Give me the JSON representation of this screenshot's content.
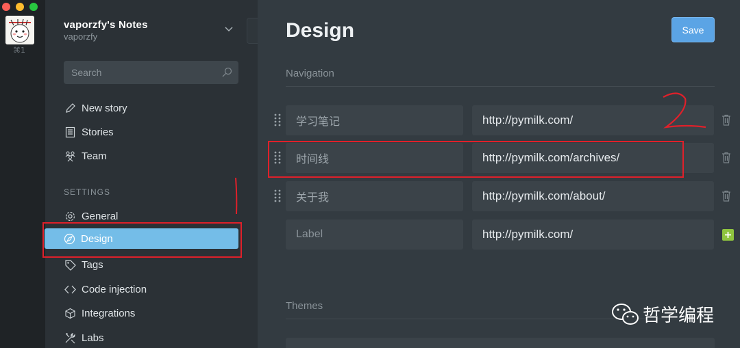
{
  "rail": {
    "avatar_icon": "avatar-sticker",
    "shortcut": "⌘1"
  },
  "sidebar": {
    "blog_title": "vaporzfy's Notes",
    "blog_user": "vaporzfy",
    "search_placeholder": "Search",
    "items": [
      {
        "label": "New story",
        "icon": "pen-icon"
      },
      {
        "label": "Stories",
        "icon": "list-icon"
      },
      {
        "label": "Team",
        "icon": "team-icon"
      }
    ],
    "settings_heading": "SETTINGS",
    "settings_items": [
      {
        "label": "General",
        "icon": "gear-icon"
      },
      {
        "label": "Design",
        "icon": "compass-icon",
        "active": true
      },
      {
        "label": "Tags",
        "icon": "tag-icon"
      },
      {
        "label": "Code injection",
        "icon": "code-icon"
      },
      {
        "label": "Integrations",
        "icon": "box-icon"
      },
      {
        "label": "Labs",
        "icon": "tools-icon"
      }
    ]
  },
  "main": {
    "title": "Design",
    "save_label": "Save",
    "navigation_heading": "Navigation",
    "nav_rows": [
      {
        "label": "学习笔记",
        "url": "http://pymilk.com/"
      },
      {
        "label": "时间线",
        "url": "http://pymilk.com/archives/"
      },
      {
        "label": "关于我",
        "url": "http://pymilk.com/about/"
      }
    ],
    "new_row": {
      "label_placeholder": "Label",
      "url": "http://pymilk.com/"
    },
    "themes_heading": "Themes"
  },
  "annotations": {
    "mark_1": "1",
    "mark_2": "2"
  },
  "watermark": "哲学编程",
  "colors": {
    "accent": "#74bde8",
    "save": "#5ba4e5",
    "add": "#8fc43f",
    "annotation": "#e0202a"
  }
}
